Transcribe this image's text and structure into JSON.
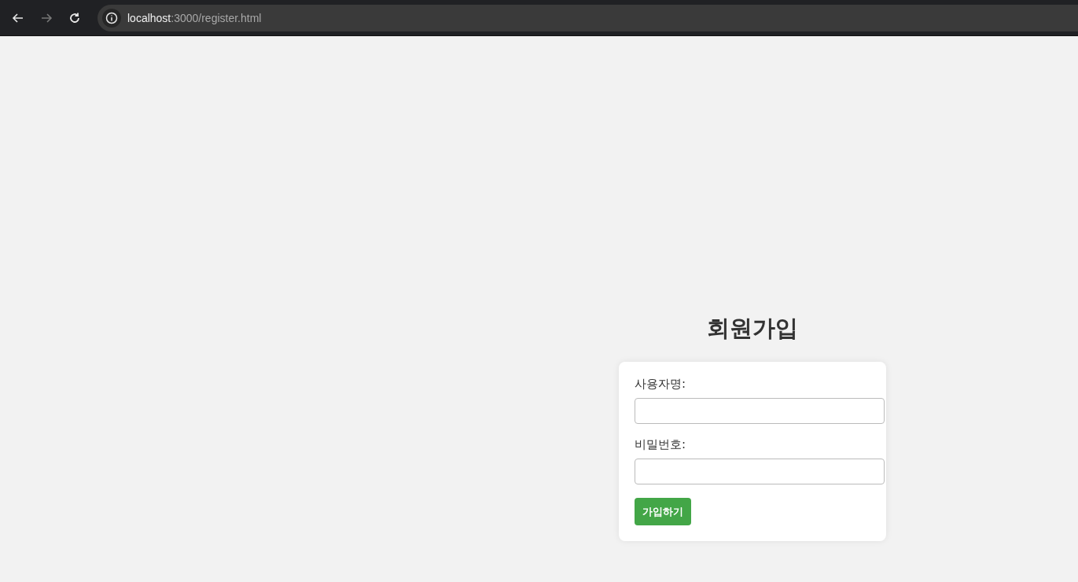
{
  "browser": {
    "url_host": "localhost",
    "url_path": ":3000/register.html"
  },
  "title": "회원가입",
  "fields": [
    {
      "label": "사용자명:"
    },
    {
      "label": "비밀번호:"
    }
  ],
  "submit": "가입하기"
}
